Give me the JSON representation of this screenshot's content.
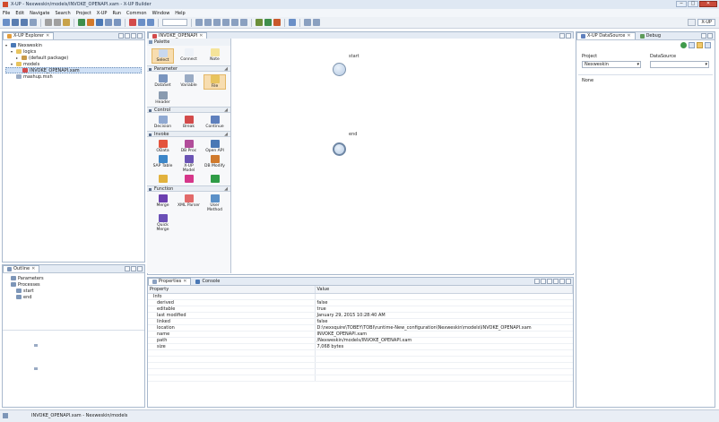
{
  "window": {
    "title": "X-UP - Nexweskin/models/INVOKE_OPENAPI.xam - X-UP Builder",
    "min_label": "─",
    "max_label": "□",
    "close_label": "✕"
  },
  "menu": [
    "File",
    "Edit",
    "Navigate",
    "Search",
    "Project",
    "X-UP",
    "Run",
    "Common",
    "Window",
    "Help"
  ],
  "perspective": {
    "label": "X-UP"
  },
  "explorer": {
    "tab": "X-UP Explorer",
    "items": [
      {
        "label": "Nexweskin",
        "indent": 0,
        "twisty": "▾",
        "icon": "project-icon"
      },
      {
        "label": "logics",
        "indent": 1,
        "twisty": "▾",
        "icon": "folder-icon"
      },
      {
        "label": "(default package)",
        "indent": 2,
        "twisty": "▸",
        "icon": "package-icon"
      },
      {
        "label": "models",
        "indent": 1,
        "twisty": "▾",
        "icon": "folder-icon"
      },
      {
        "label": "INVOKE_OPENAPI.xam",
        "indent": 2,
        "twisty": "",
        "icon": "model-file-icon",
        "selected": true
      },
      {
        "label": "mashup.mxh",
        "indent": 1,
        "twisty": "",
        "icon": "file-icon"
      }
    ]
  },
  "outline": {
    "tab": "Outline",
    "items": [
      {
        "label": "Parameters",
        "indent": 1
      },
      {
        "label": "Processes",
        "indent": 1
      },
      {
        "label": "start",
        "indent": 2
      },
      {
        "label": "end",
        "indent": 2
      }
    ]
  },
  "editor": {
    "tab": "INVOKE_OPENAPI",
    "palette": {
      "title": "Palette",
      "tools": [
        {
          "label": "Select",
          "color": "#c9d8ee",
          "selected": true
        },
        {
          "label": "Connect",
          "color": "#eef2f8"
        },
        {
          "label": "Note",
          "color": "#f5e49a"
        }
      ],
      "drawers": [
        {
          "name": "Parameter",
          "items": [
            {
              "label": "DataSet",
              "color": "#7a95bf"
            },
            {
              "label": "Variable",
              "color": "#9aabc4"
            },
            {
              "label": "File",
              "color": "#e8c45e",
              "selected": true
            },
            {
              "label": "Header",
              "color": "#8a9bb0"
            }
          ]
        },
        {
          "name": "Control",
          "items": [
            {
              "label": "Decision",
              "color": "#90a9d2"
            },
            {
              "label": "Break",
              "color": "#d34b4b"
            },
            {
              "label": "Continue",
              "color": "#5f80bd"
            }
          ]
        },
        {
          "name": "Invoke",
          "items": [
            {
              "label": "OData",
              "color": "#e4543d"
            },
            {
              "label": "DB Proc",
              "color": "#b14d9a"
            },
            {
              "label": "Open API",
              "color": "#4a78b5"
            },
            {
              "label": "SAP Table",
              "color": "#3c86c8"
            },
            {
              "label": "X-UP Model",
              "color": "#6b54b5"
            },
            {
              "label": "DB Modify",
              "color": "#d07a2d"
            },
            {
              "label": "",
              "color": "#e2b23d"
            },
            {
              "label": "",
              "color": "#d6378a"
            },
            {
              "label": "",
              "color": "#2f9c46"
            }
          ]
        },
        {
          "name": "Function",
          "items": [
            {
              "label": "Merge",
              "color": "#6b3fb0"
            },
            {
              "label": "XML Parser",
              "color": "#e26a6a"
            },
            {
              "label": "User Method",
              "color": "#5a90c8"
            },
            {
              "label": "Quick Merge",
              "color": "#6a4fb6"
            }
          ]
        }
      ]
    },
    "nodes": [
      {
        "label": "start",
        "type": "start"
      },
      {
        "label": "end",
        "type": "end"
      }
    ]
  },
  "properties": {
    "tabs": [
      "Properties",
      "Console"
    ],
    "columns": [
      "Property",
      "Value"
    ],
    "group": "Info",
    "rows": [
      {
        "key": "derived",
        "value": "false"
      },
      {
        "key": "editable",
        "value": "true"
      },
      {
        "key": "last modified",
        "value": "January 29, 2015 10:28:40 AM"
      },
      {
        "key": "linked",
        "value": "false"
      },
      {
        "key": "location",
        "value": "D:\\nexsquire\\TOBEY\\TOBI\\runtime-New_configuration\\Nexweskin\\models\\INVOKE_OPENAPI.xam"
      },
      {
        "key": "name",
        "value": "INVOKE_OPENAPI.xam"
      },
      {
        "key": "path",
        "value": "/Nexweskin/models/INVOKE_OPENAPI.xam"
      },
      {
        "key": "size",
        "value": "7,068 bytes"
      }
    ]
  },
  "datasource": {
    "tabs": [
      "X-UP DataSource",
      "Debug"
    ],
    "project_label": "Project",
    "project_value": "Nexweskin",
    "datasource_label": "DataSource",
    "datasource_value": "",
    "section": "None"
  },
  "status": {
    "text": "INVOKE_OPENAPI.xam - Nexweskin/models"
  }
}
